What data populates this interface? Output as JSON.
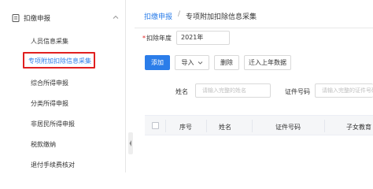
{
  "sidebar": {
    "section_label": "扣缴申报",
    "section_icon": "document-icon",
    "items": [
      {
        "label": "人员信息采集",
        "active": false
      },
      {
        "label": "专项附加扣除信息采集",
        "active": true
      },
      {
        "label": "综合所得申报",
        "active": false
      },
      {
        "label": "分类所得申报",
        "active": false
      },
      {
        "label": "非居民所得申报",
        "active": false
      },
      {
        "label": "税款缴纳",
        "active": false
      },
      {
        "label": "退付手续费核对",
        "active": false
      }
    ]
  },
  "breadcrumb": {
    "parent": "扣缴申报",
    "separator": "/",
    "current": "专项附加扣除信息采集"
  },
  "year": {
    "required_mark": "*",
    "label": "扣除年度",
    "value": "2021年"
  },
  "toolbar": {
    "add": "添加",
    "import": "导入",
    "delete": "删除",
    "migrate": "迁入上年数据"
  },
  "search": {
    "name_label": "姓名",
    "name_placeholder": "请输入完整的姓名",
    "id_label": "证件号码",
    "id_placeholder": "请输入完整的证件号码"
  },
  "table": {
    "columns": [
      "序号",
      "姓名",
      "证件号码",
      "子女教育"
    ]
  },
  "colors": {
    "accent": "#2b7de9",
    "highlight": "#e02020"
  }
}
